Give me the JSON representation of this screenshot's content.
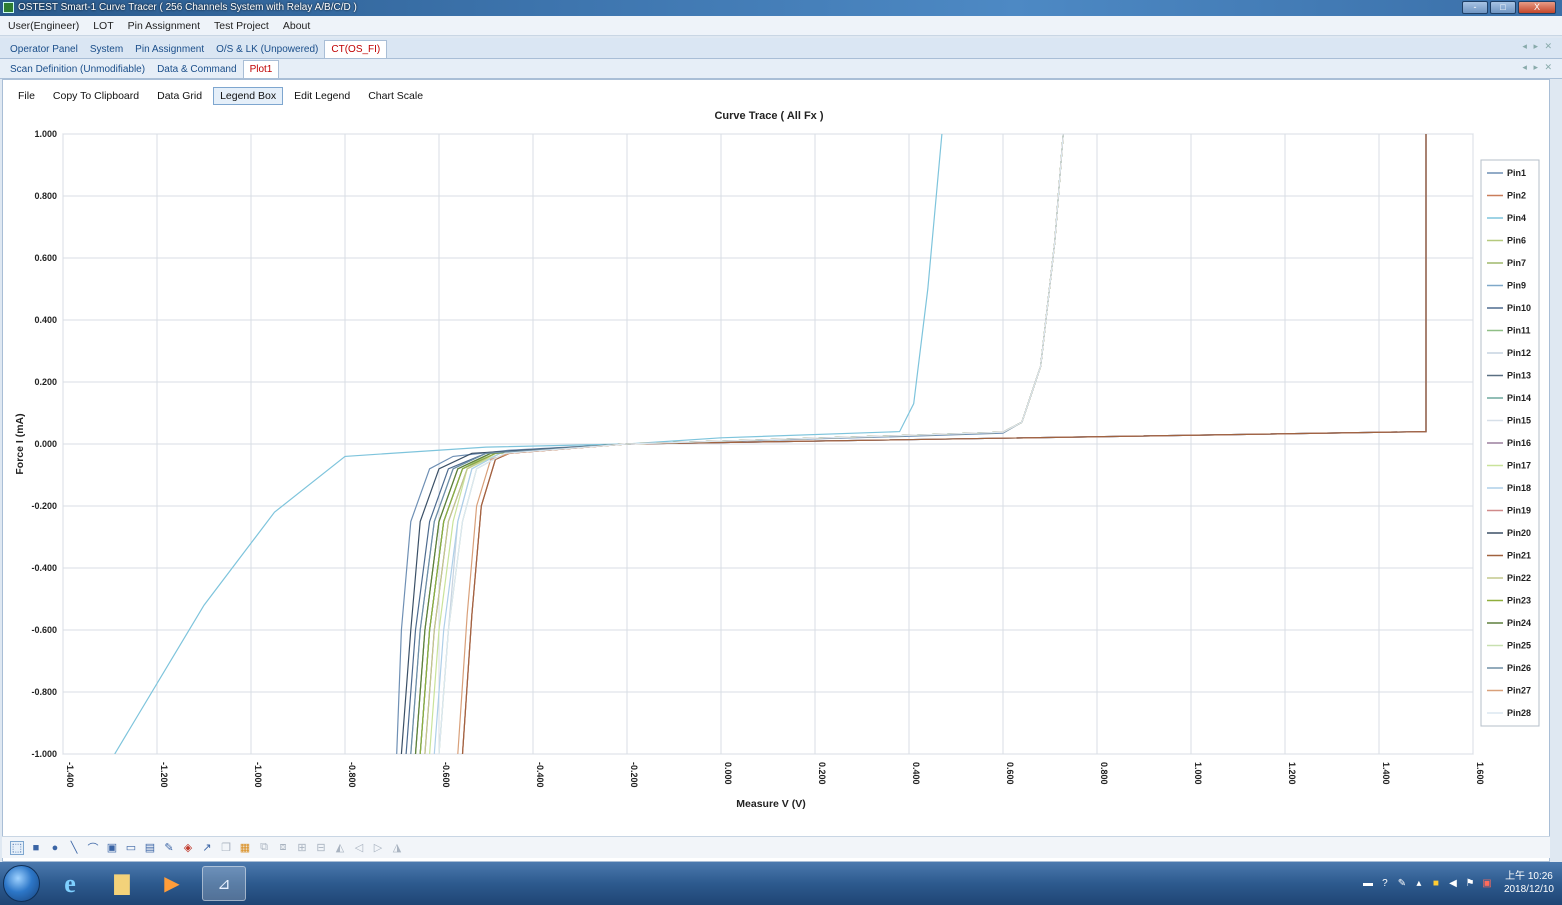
{
  "window": {
    "title": "OSTEST Smart-1 Curve Tracer ( 256 Channels System with Relay A/B/C/D )",
    "buttons": [
      "-",
      "□",
      "X"
    ]
  },
  "menu": [
    "User(Engineer)",
    "LOT",
    "Pin Assignment",
    "Test Project",
    "About"
  ],
  "tabs_primary": [
    {
      "label": "Operator Panel",
      "active": false
    },
    {
      "label": "System",
      "active": false
    },
    {
      "label": "Pin Assignment",
      "active": false
    },
    {
      "label": "O/S & LK (Unpowered)",
      "active": false
    },
    {
      "label": "CT(OS_FI)",
      "active": true
    }
  ],
  "tabs_secondary": [
    {
      "label": "Scan Definition (Unmodifiable)",
      "active": false
    },
    {
      "label": "Data & Command",
      "active": false
    },
    {
      "label": "Plot1",
      "active": true
    }
  ],
  "plot_toolbar": [
    {
      "label": "File",
      "active": false
    },
    {
      "label": "Copy To Clipboard",
      "active": false
    },
    {
      "label": "Data Grid",
      "active": false
    },
    {
      "label": "Legend Box",
      "active": true
    },
    {
      "label": "Edit Legend",
      "active": false
    },
    {
      "label": "Chart Scale",
      "active": false
    }
  ],
  "chart_data": {
    "type": "line",
    "title": "Curve Trace ( All Fx )",
    "xlabel": "Measure V (V)",
    "ylabel": "Force I (mA)",
    "xlim": [
      -1.4,
      1.6
    ],
    "ylim": [
      -1.0,
      1.0
    ],
    "x_ticks": [
      "-1.400",
      "-1.200",
      "-1.000",
      "-0.800",
      "-0.600",
      "-0.400",
      "-0.200",
      "0.000",
      "0.200",
      "0.400",
      "0.600",
      "0.800",
      "1.000",
      "1.200",
      "1.400",
      "1.600"
    ],
    "y_ticks": [
      "1.000",
      "0.800",
      "0.600",
      "0.400",
      "0.200",
      "0.000",
      "-0.200",
      "-0.400",
      "-0.600",
      "-0.800",
      "-1.000"
    ],
    "grid": true,
    "legend_position": "right",
    "series": [
      {
        "name": "Pin1",
        "color": "#6e8fb4",
        "x": [
          -0.69,
          -0.68,
          -0.66,
          -0.62,
          -0.57,
          -0.45,
          -0.2,
          0.4,
          0.6,
          0.64,
          0.68,
          0.71,
          0.728
        ],
        "y": [
          -1.0,
          -0.6,
          -0.25,
          -0.08,
          -0.04,
          -0.02,
          0.0,
          0.025,
          0.035,
          0.07,
          0.25,
          0.65,
          1.0
        ]
      },
      {
        "name": "Pin2",
        "color": "#c97d5a",
        "x": [
          -0.55,
          -0.53,
          -0.51,
          -0.48,
          -0.45,
          -0.2,
          0.4,
          0.6,
          0.64,
          0.68,
          0.71,
          0.728
        ],
        "y": [
          -1.0,
          -0.55,
          -0.2,
          -0.05,
          -0.03,
          0.0,
          0.028,
          0.038,
          0.07,
          0.25,
          0.65,
          1.0
        ]
      },
      {
        "name": "Pin4",
        "color": "#7ec4dc",
        "x": [
          -1.29,
          -1.1,
          -0.95,
          -0.8,
          -0.5,
          -0.2,
          0.0,
          0.38,
          0.41,
          0.44,
          0.47
        ],
        "y": [
          -1.0,
          -0.52,
          -0.22,
          -0.04,
          -0.01,
          0.0,
          0.02,
          0.04,
          0.13,
          0.5,
          1.0
        ]
      },
      {
        "name": "Pin6",
        "color": "#b5c97d",
        "x": [
          -0.64,
          -0.62,
          -0.59,
          -0.55,
          -0.49,
          -0.2,
          0.4,
          0.6,
          0.64,
          0.68,
          0.71,
          0.728
        ],
        "y": [
          -1.0,
          -0.6,
          -0.25,
          -0.08,
          -0.03,
          0.0,
          0.028,
          0.038,
          0.07,
          0.25,
          0.65,
          1.0
        ]
      },
      {
        "name": "Pin7",
        "color": "#9fb86a",
        "x": [
          -0.65,
          -0.63,
          -0.6,
          -0.56,
          -0.49,
          -0.2,
          0.4,
          0.6,
          0.64,
          0.68,
          0.71,
          0.728
        ],
        "y": [
          -1.0,
          -0.6,
          -0.25,
          -0.08,
          -0.03,
          0.0,
          0.028,
          0.038,
          0.07,
          0.25,
          0.65,
          1.0
        ]
      },
      {
        "name": "Pin9",
        "color": "#7fa8c9",
        "x": [
          -0.66,
          -0.64,
          -0.61,
          -0.57,
          -0.5,
          -0.2,
          1.5,
          1.5
        ],
        "y": [
          -1.0,
          -0.6,
          -0.25,
          -0.08,
          -0.03,
          0.0,
          0.04,
          1.0
        ]
      },
      {
        "name": "Pin10",
        "color": "#4d6b8f",
        "x": [
          -0.67,
          -0.65,
          -0.62,
          -0.58,
          -0.5,
          -0.2,
          1.5,
          1.5
        ],
        "y": [
          -1.0,
          -0.6,
          -0.25,
          -0.08,
          -0.03,
          0.0,
          0.04,
          1.0
        ]
      },
      {
        "name": "Pin11",
        "color": "#8fbf86",
        "x": [
          -0.65,
          -0.63,
          -0.6,
          -0.56,
          -0.49,
          -0.2,
          0.4,
          0.6,
          0.64,
          0.68,
          0.71,
          0.728
        ],
        "y": [
          -1.0,
          -0.6,
          -0.25,
          -0.08,
          -0.03,
          0.0,
          0.028,
          0.038,
          0.07,
          0.25,
          0.65,
          1.0
        ]
      },
      {
        "name": "Pin12",
        "color": "#c6d3e0",
        "x": [
          -0.6,
          -0.58,
          -0.56,
          -0.53,
          -0.47,
          -0.2,
          0.4,
          0.6,
          0.64,
          0.68,
          0.71,
          0.728
        ],
        "y": [
          -1.0,
          -0.6,
          -0.25,
          -0.08,
          -0.03,
          0.0,
          0.028,
          0.038,
          0.07,
          0.25,
          0.65,
          1.0
        ]
      },
      {
        "name": "Pin13",
        "color": "#5a6f82",
        "x": [
          -0.64,
          -0.62,
          -0.59,
          -0.55,
          -0.48,
          -0.2,
          1.5,
          1.5
        ],
        "y": [
          -1.0,
          -0.6,
          -0.25,
          -0.08,
          -0.03,
          0.0,
          0.04,
          1.0
        ]
      },
      {
        "name": "Pin14",
        "color": "#6da89e",
        "x": [
          -0.64,
          -0.62,
          -0.59,
          -0.55,
          -0.48,
          -0.2,
          0.4,
          0.6,
          0.64,
          0.68,
          0.71,
          0.728
        ],
        "y": [
          -1.0,
          -0.6,
          -0.25,
          -0.08,
          -0.03,
          0.0,
          0.028,
          0.038,
          0.07,
          0.25,
          0.65,
          1.0
        ]
      },
      {
        "name": "Pin15",
        "color": "#d6dfe8",
        "x": [
          -0.6,
          -0.58,
          -0.55,
          -0.52,
          -0.46,
          -0.2,
          0.4,
          0.6,
          0.64,
          0.68,
          0.71,
          0.728
        ],
        "y": [
          -1.0,
          -0.6,
          -0.25,
          -0.08,
          -0.03,
          0.0,
          0.028,
          0.038,
          0.07,
          0.25,
          0.65,
          1.0
        ]
      },
      {
        "name": "Pin16",
        "color": "#9a7f9e",
        "x": [
          -0.63,
          -0.61,
          -0.58,
          -0.54,
          -0.48,
          -0.2,
          0.4,
          0.6,
          0.64,
          0.68,
          0.71,
          0.728
        ],
        "y": [
          -1.0,
          -0.6,
          -0.25,
          -0.08,
          -0.03,
          0.0,
          0.028,
          0.038,
          0.07,
          0.25,
          0.65,
          1.0
        ]
      },
      {
        "name": "Pin17",
        "color": "#c9e39a",
        "x": [
          -0.62,
          -0.6,
          -0.57,
          -0.54,
          -0.47,
          -0.2,
          0.4,
          0.6,
          0.64,
          0.68,
          0.71,
          0.728
        ],
        "y": [
          -1.0,
          -0.6,
          -0.25,
          -0.08,
          -0.03,
          0.0,
          0.028,
          0.038,
          0.07,
          0.25,
          0.65,
          1.0
        ]
      },
      {
        "name": "Pin18",
        "color": "#aecfe8",
        "x": [
          -0.61,
          -0.59,
          -0.56,
          -0.53,
          -0.47,
          -0.2,
          0.4,
          0.6,
          0.64,
          0.68,
          0.71,
          0.728
        ],
        "y": [
          -1.0,
          -0.6,
          -0.25,
          -0.08,
          -0.03,
          0.0,
          0.028,
          0.038,
          0.07,
          0.25,
          0.65,
          1.0
        ]
      },
      {
        "name": "Pin19",
        "color": "#d08a8a",
        "x": [
          -0.55,
          -0.53,
          -0.51,
          -0.48,
          -0.45,
          -0.2,
          1.5,
          1.5
        ],
        "y": [
          -1.0,
          -0.55,
          -0.2,
          -0.05,
          -0.03,
          0.0,
          0.04,
          1.0
        ]
      },
      {
        "name": "Pin20",
        "color": "#3a4f66",
        "x": [
          -0.68,
          -0.66,
          -0.64,
          -0.6,
          -0.53,
          -0.2,
          0.4,
          0.6,
          0.64,
          0.68,
          0.71,
          0.728
        ],
        "y": [
          -1.0,
          -0.6,
          -0.25,
          -0.08,
          -0.03,
          0.0,
          0.028,
          0.038,
          0.07,
          0.25,
          0.65,
          1.0
        ]
      },
      {
        "name": "Pin21",
        "color": "#a0623f",
        "x": [
          -0.55,
          -0.53,
          -0.51,
          -0.48,
          -0.45,
          -0.2,
          1.5,
          1.5
        ],
        "y": [
          -1.0,
          -0.55,
          -0.2,
          -0.05,
          -0.03,
          0.0,
          0.04,
          1.0
        ]
      },
      {
        "name": "Pin22",
        "color": "#c3c98c",
        "x": [
          -0.63,
          -0.61,
          -0.58,
          -0.54,
          -0.48,
          -0.2,
          0.4,
          0.6,
          0.64,
          0.68,
          0.71,
          0.728
        ],
        "y": [
          -1.0,
          -0.6,
          -0.25,
          -0.08,
          -0.03,
          0.0,
          0.028,
          0.038,
          0.07,
          0.25,
          0.65,
          1.0
        ]
      },
      {
        "name": "Pin23",
        "color": "#8fae3c",
        "x": [
          -0.64,
          -0.62,
          -0.59,
          -0.55,
          -0.48,
          -0.2,
          0.4,
          0.6,
          0.64,
          0.68,
          0.71,
          0.728
        ],
        "y": [
          -1.0,
          -0.6,
          -0.25,
          -0.08,
          -0.03,
          0.0,
          0.028,
          0.038,
          0.07,
          0.25,
          0.65,
          1.0
        ]
      },
      {
        "name": "Pin24",
        "color": "#5e7f3c",
        "x": [
          -0.65,
          -0.63,
          -0.6,
          -0.56,
          -0.49,
          -0.2,
          0.4,
          0.6,
          0.64,
          0.68,
          0.71,
          0.728
        ],
        "y": [
          -1.0,
          -0.6,
          -0.25,
          -0.08,
          -0.03,
          0.0,
          0.028,
          0.038,
          0.07,
          0.25,
          0.65,
          1.0
        ]
      },
      {
        "name": "Pin25",
        "color": "#c8e0b0",
        "x": [
          -0.6,
          -0.58,
          -0.55,
          -0.52,
          -0.46,
          -0.2,
          0.4,
          0.6,
          0.64,
          0.68,
          0.71,
          0.728
        ],
        "y": [
          -1.0,
          -0.6,
          -0.25,
          -0.08,
          -0.03,
          0.0,
          0.028,
          0.038,
          0.07,
          0.25,
          0.65,
          1.0
        ]
      },
      {
        "name": "Pin26",
        "color": "#6f8fa6",
        "x": [
          -0.66,
          -0.64,
          -0.61,
          -0.57,
          -0.5,
          -0.2,
          0.4,
          0.6,
          0.64,
          0.68,
          0.71,
          0.728
        ],
        "y": [
          -1.0,
          -0.6,
          -0.25,
          -0.08,
          -0.03,
          0.0,
          0.028,
          0.038,
          0.07,
          0.25,
          0.65,
          1.0
        ]
      },
      {
        "name": "Pin27",
        "color": "#d9a07a",
        "x": [
          -0.56,
          -0.54,
          -0.52,
          -0.49,
          -0.45,
          -0.2,
          0.4,
          0.6,
          0.64,
          0.68,
          0.71,
          0.728
        ],
        "y": [
          -1.0,
          -0.55,
          -0.2,
          -0.05,
          -0.03,
          0.0,
          0.028,
          0.038,
          0.07,
          0.25,
          0.65,
          1.0
        ]
      },
      {
        "name": "Pin28",
        "color": "#dbe7f1",
        "x": [
          -0.6,
          -0.58,
          -0.55,
          -0.52,
          -0.46,
          -0.2,
          0.4,
          0.6,
          0.64,
          0.68,
          0.71,
          0.728
        ],
        "y": [
          -1.0,
          -0.6,
          -0.25,
          -0.08,
          -0.03,
          0.0,
          0.028,
          0.038,
          0.07,
          0.25,
          0.65,
          1.0
        ]
      }
    ]
  },
  "draw_toolbar_icons": [
    "select-icon",
    "rectangle-icon",
    "ellipse-icon",
    "line-icon",
    "arc-icon",
    "image-icon",
    "textbox-icon",
    "comment-icon",
    "pen-icon",
    "fill-color-icon",
    "line-color-icon",
    "copy-icon",
    "paste-icon",
    "group-icon",
    "ungroup-icon",
    "bring-front-icon",
    "send-back-icon",
    "align-left-icon",
    "align-center-icon",
    "align-right-icon",
    "align-top-icon"
  ],
  "taskbar": {
    "apps": [
      "start-orb",
      "internet-explorer-icon",
      "file-explorer-icon",
      "media-player-icon",
      "curve-tracer-app-icon"
    ],
    "clock_time": "上午 10:26",
    "clock_date": "2018/12/10"
  }
}
